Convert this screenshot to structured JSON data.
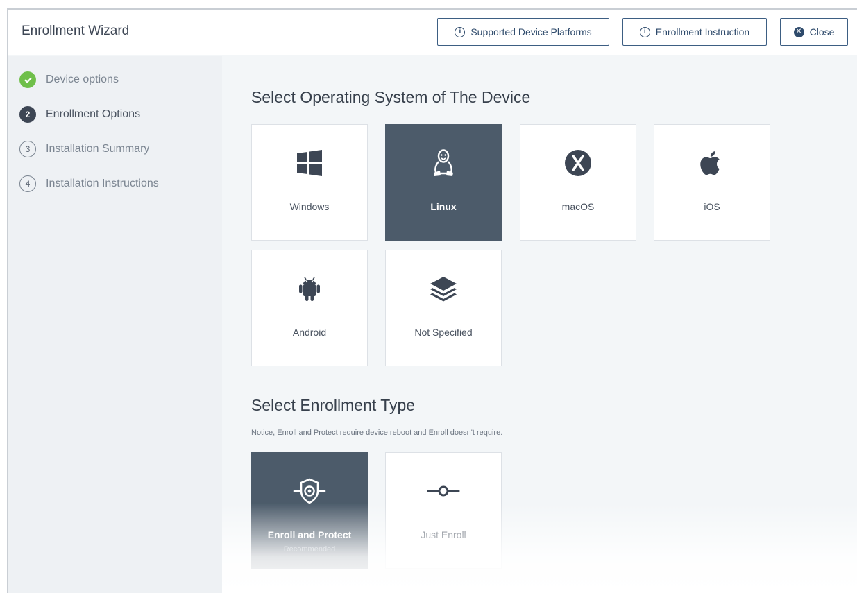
{
  "header": {
    "title": "Enrollment Wizard",
    "buttons": {
      "supported_platforms": "Supported Device Platforms",
      "enrollment_instruction": "Enrollment Instruction",
      "close": "Close"
    }
  },
  "steps": [
    {
      "number": "✓",
      "label": "Device options",
      "state": "done"
    },
    {
      "number": "2",
      "label": "Enrollment Options",
      "state": "active"
    },
    {
      "number": "3",
      "label": "Installation Summary",
      "state": "todo"
    },
    {
      "number": "4",
      "label": "Installation Instructions",
      "state": "todo"
    }
  ],
  "os_section": {
    "title": "Select Operating System of The Device",
    "options": [
      {
        "label": "Windows",
        "icon": "windows-icon",
        "selected": false
      },
      {
        "label": "Linux",
        "icon": "linux-icon",
        "selected": true
      },
      {
        "label": "macOS",
        "icon": "macos-icon",
        "selected": false
      },
      {
        "label": "iOS",
        "icon": "apple-icon",
        "selected": false
      },
      {
        "label": "Android",
        "icon": "android-icon",
        "selected": false
      },
      {
        "label": "Not Specified",
        "icon": "layers-icon",
        "selected": false
      }
    ]
  },
  "enrollment_section": {
    "title": "Select Enrollment Type",
    "notice": "Notice, Enroll and Protect require device reboot and Enroll doesn't require.",
    "options": [
      {
        "label": "Enroll and Protect",
        "sublabel": "Recommended",
        "icon": "shield-gear-icon",
        "selected": true
      },
      {
        "label": "Just Enroll",
        "icon": "commit-icon",
        "selected": false
      }
    ]
  },
  "colors": {
    "accent": "#2e4a6b",
    "selected_tile": "#4c5b6a",
    "done": "#6fbf4a"
  }
}
